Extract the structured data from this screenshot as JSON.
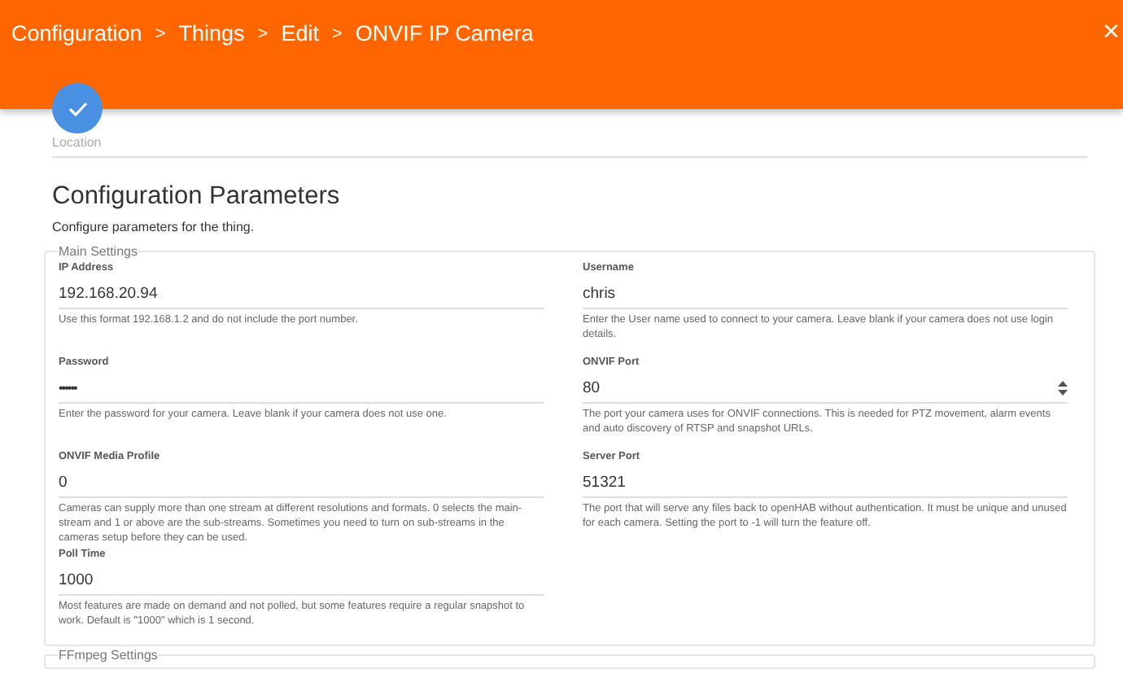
{
  "header": {
    "breadcrumbs": [
      "Configuration",
      "Things",
      "Edit",
      "ONVIF IP Camera"
    ],
    "separator": ">",
    "close": "×"
  },
  "step": {
    "label": "Location",
    "done": true
  },
  "section": {
    "title": "Configuration Parameters",
    "subtitle": "Configure parameters for the thing."
  },
  "groups": [
    {
      "legend": "Main Settings",
      "fields": [
        {
          "kind": "text",
          "label": "IP Address",
          "value": "192.168.20.94",
          "description": "Use this format 192.168.1.2 and do not include the port number."
        },
        {
          "kind": "text",
          "label": "Username",
          "value": "chris",
          "description": "Enter the User name used to connect to your camera. Leave blank if your camera does not use login details."
        },
        {
          "kind": "password",
          "label": "Password",
          "value": "••••••",
          "description": "Enter the password for your camera. Leave blank if your camera does not use one."
        },
        {
          "kind": "number",
          "label": "ONVIF Port",
          "value": "80",
          "description": "The port your camera uses for ONVIF connections. This is needed for PTZ movement, alarm events and auto discovery of RTSP and snapshot URLs."
        },
        {
          "kind": "text",
          "label": "ONVIF Media Profile",
          "value": "0",
          "description": "Cameras can supply more than one stream at different resolutions and formats. 0 selects the main-stream and 1 or above are the sub-streams. Sometimes you need to turn on sub-streams in the cameras setup before they can be used."
        },
        {
          "kind": "text",
          "label": "Server Port",
          "value": "51321",
          "description": "The port that will serve any files back to openHAB without authentication. It must be unique and unused for each camera. Setting the port to -1 will turn the feature off."
        },
        {
          "kind": "text",
          "label": "Poll Time",
          "value": "1000",
          "description": "Most features are made on demand and not polled, but some features require a regular snapshot to work. Default is \"1000\" which is 1 second."
        }
      ]
    },
    {
      "legend": "FFmpeg Settings"
    }
  ]
}
